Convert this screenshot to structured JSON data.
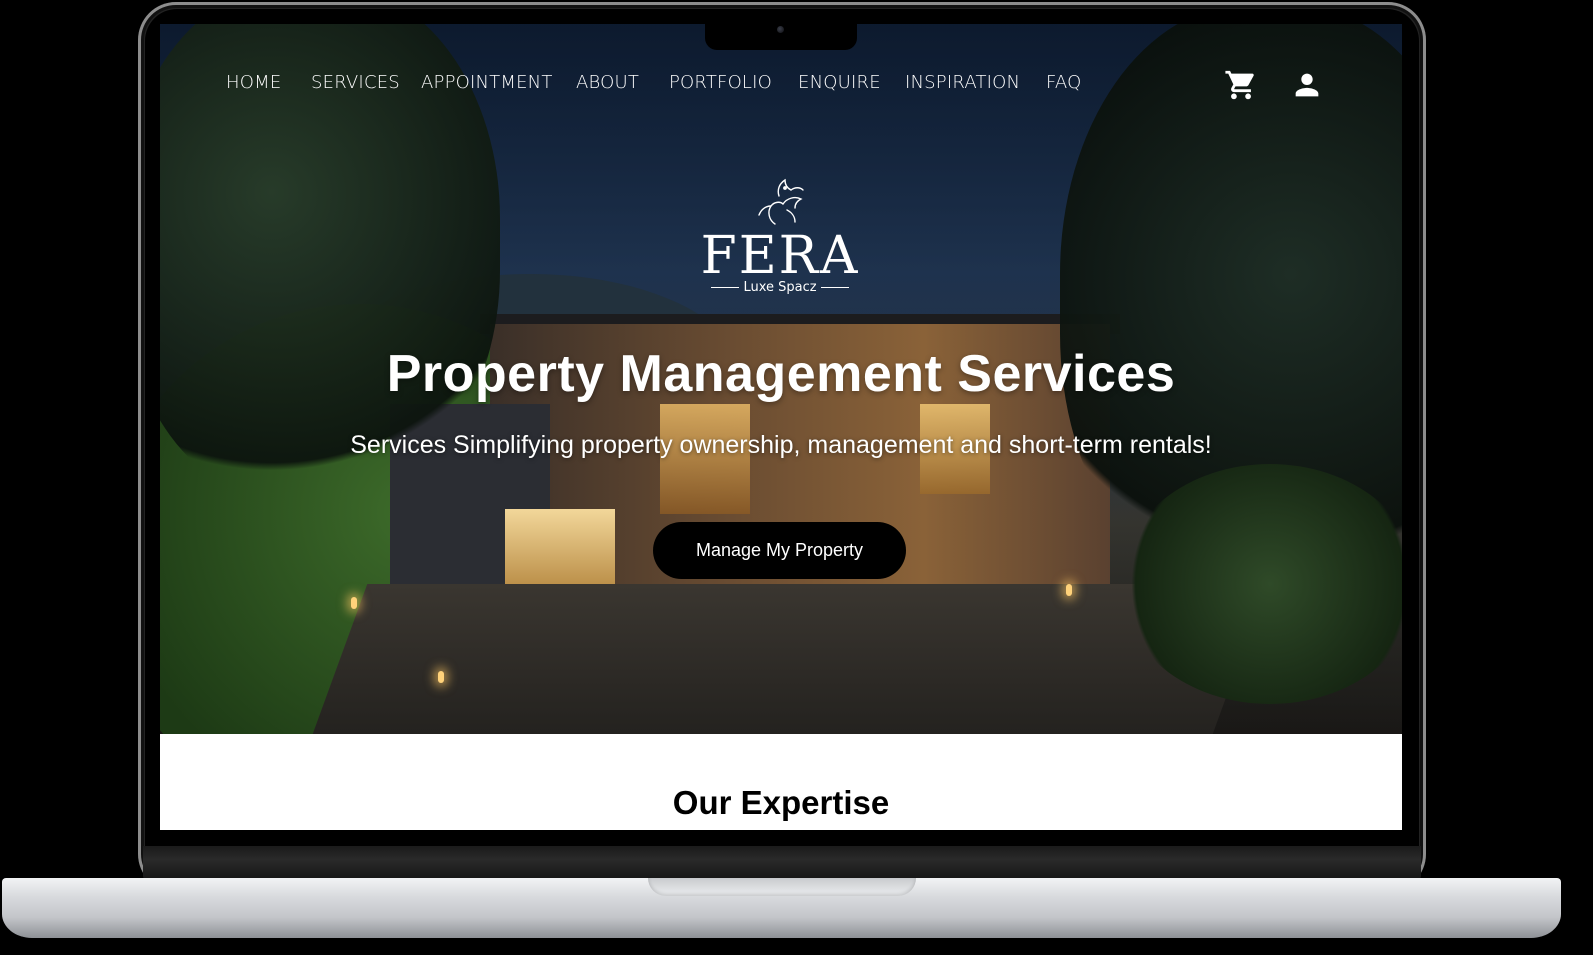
{
  "nav": {
    "items": [
      "HOME",
      "SERVICES",
      "APPOINTMENT",
      "ABOUT",
      "PORTFOLIO",
      "ENQUIRE",
      "INSPIRATION",
      "FAQ"
    ]
  },
  "icons": {
    "cart": "cart-icon",
    "account": "user-icon"
  },
  "logo": {
    "word": "FERA",
    "tagline": "Luxe Spacz"
  },
  "hero": {
    "title": "Property Management Services",
    "subtitle": "Services Simplifying property ownership, management and short-term rentals!",
    "cta_label": "Manage My Property"
  },
  "section": {
    "heading": "Our Expertise"
  },
  "colors": {
    "cta_bg": "#000000",
    "text_light": "#ffffff",
    "frame_silver": "#d9dbde"
  }
}
